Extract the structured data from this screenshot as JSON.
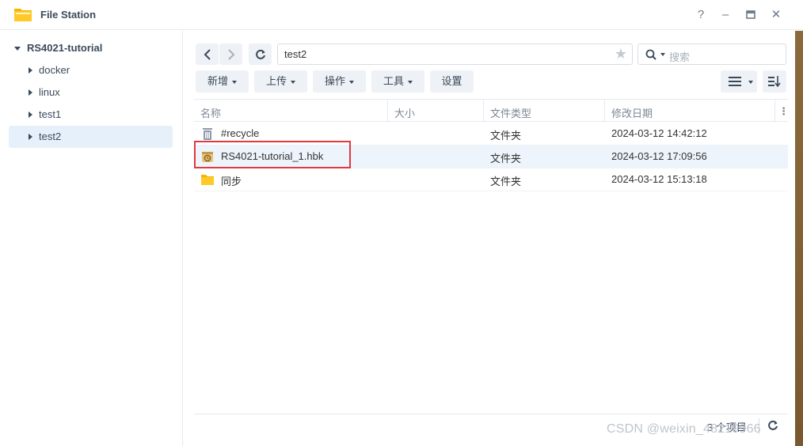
{
  "window": {
    "title": "File Station",
    "controls": [
      "help-icon",
      "minimize-icon",
      "maximize-icon",
      "close-icon"
    ]
  },
  "sidebar": {
    "root": "RS4021-tutorial",
    "items": [
      {
        "label": "docker"
      },
      {
        "label": "linux"
      },
      {
        "label": "test1"
      },
      {
        "label": "test2",
        "selected": true
      }
    ]
  },
  "toolbar": {
    "path": "test2",
    "search_placeholder": "搜索",
    "buttons": [
      {
        "label": "新增",
        "dropdown": true
      },
      {
        "label": "上传",
        "dropdown": true
      },
      {
        "label": "操作",
        "dropdown": true
      },
      {
        "label": "工具",
        "dropdown": true
      },
      {
        "label": "设置",
        "dropdown": false
      }
    ]
  },
  "table": {
    "columns": [
      "名称",
      "大小",
      "文件类型",
      "修改日期"
    ],
    "rows": [
      {
        "name": "#recycle",
        "size": "",
        "type": "文件夹",
        "modified": "2024-03-12 14:42:12",
        "icon": "recycle-bin-icon"
      },
      {
        "name": "RS4021-tutorial_1.hbk",
        "size": "",
        "type": "文件夹",
        "modified": "2024-03-12 17:09:56",
        "icon": "backup-folder-icon",
        "highlighted": true
      },
      {
        "name": "同步",
        "size": "",
        "type": "文件夹",
        "modified": "2024-03-12 15:13:18",
        "icon": "folder-icon"
      }
    ]
  },
  "status": {
    "count": "3 个项目"
  },
  "watermark": "CSDN @weixin_48219966",
  "colors": {
    "accent": "#e6f0fb",
    "highlight_border": "#e0393e",
    "folder": "#f5b400"
  }
}
